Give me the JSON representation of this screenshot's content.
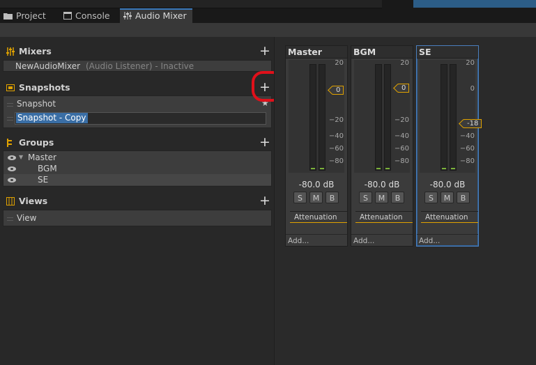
{
  "tabs": [
    {
      "label": "Project",
      "icon": "folder-icon"
    },
    {
      "label": "Console",
      "icon": "console-icon"
    },
    {
      "label": "Audio Mixer",
      "icon": "mixer-icon",
      "active": true
    }
  ],
  "sections": {
    "mixers": {
      "title": "Mixers",
      "add": "+"
    },
    "snapshots": {
      "title": "Snapshots",
      "add": "+"
    },
    "groups": {
      "title": "Groups",
      "add": "+"
    },
    "views": {
      "title": "Views",
      "add": "+"
    }
  },
  "mixers": [
    {
      "name": "NewAudioMixer",
      "status": "(Audio Listener) - Inactive"
    }
  ],
  "snapshots": [
    {
      "name": "Snapshot",
      "starred": true
    },
    {
      "name": "Snapshot - Copy",
      "editing": true
    }
  ],
  "groups": [
    {
      "name": "Master",
      "expanded": true
    },
    {
      "name": "BGM"
    },
    {
      "name": "SE"
    }
  ],
  "views": [
    {
      "name": "View"
    }
  ],
  "strips": [
    {
      "name": "Master",
      "level": "0",
      "db": "-80.0 dB",
      "s": "S",
      "m": "M",
      "b": "B",
      "effect": "Attenuation",
      "add": "Add..."
    },
    {
      "name": "BGM",
      "level": "0",
      "db": "-80.0 dB",
      "s": "S",
      "m": "M",
      "b": "B",
      "effect": "Attenuation",
      "add": "Add..."
    },
    {
      "name": "SE",
      "level": "-18",
      "db": "-80.0 dB",
      "s": "S",
      "m": "M",
      "b": "B",
      "effect": "Attenuation",
      "add": "Add...",
      "selected": true
    }
  ],
  "scale": [
    "20",
    "0",
    "−20",
    "−40",
    "−60",
    "−80"
  ],
  "colors": {
    "accent": "#e0a200",
    "selection": "#2c5d87",
    "highlight_ring": "#e0101a",
    "meter_green": "#7bb13a"
  }
}
